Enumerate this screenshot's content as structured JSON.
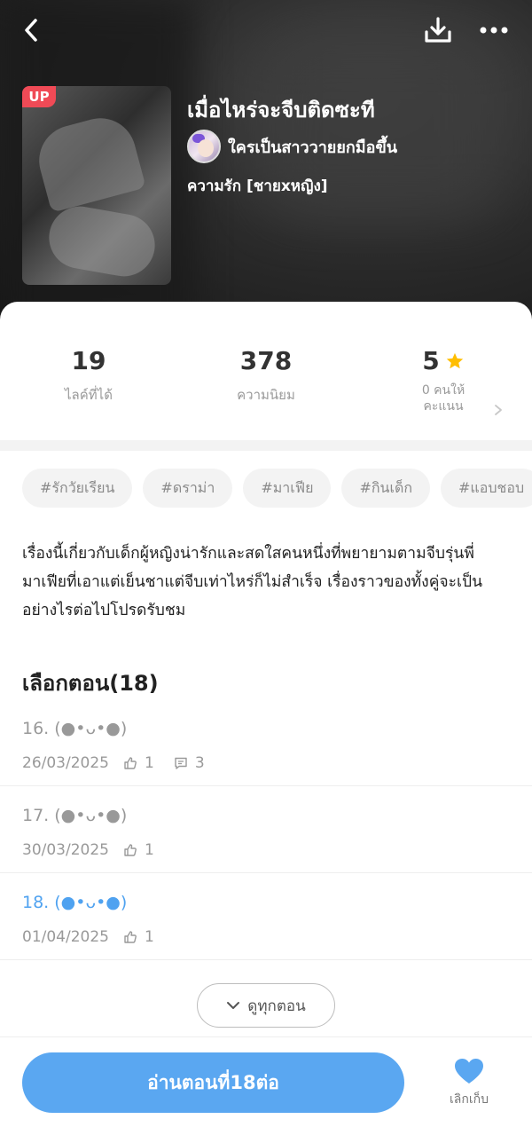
{
  "header": {
    "badge": "UP",
    "title": "เมื่อไหร่จะจีบติดซะที",
    "author": "ใครเป็นสาววายยกมือขึ้น",
    "genre": "ความรัก [ชายxหญิง]"
  },
  "stats": {
    "likes": {
      "value": "19",
      "label": "ไลค์ที่ได้"
    },
    "popularity": {
      "value": "378",
      "label": "ความนิยม"
    },
    "rating": {
      "value": "5",
      "label_line1": "0 คนให้",
      "label_line2": "คะแนน"
    }
  },
  "tags": [
    "#รักวัยเรียน",
    "#ดราม่า",
    "#มาเฟีย",
    "#กินเด็ก",
    "#แอบชอบ"
  ],
  "synopsis": "เรื่องนี้เกี่ยวกับเด็กผู้หญิงน่ารักและสดใสคนหนึ่งที่พยายามตามจีบรุ่นพี่มาเฟียที่เอาแต่เย็นชาแต่จีบเท่าไหร่ก็ไม่สำเร็จ เรื่องราวของทั้งคู่จะเป็นอย่างไรต่อไปโปรดรับชม",
  "episodes": {
    "heading": "เลือกตอน(18)",
    "items": [
      {
        "title": "16. (●•ᴗ•●)",
        "date": "26/03/2025",
        "likes": "1",
        "comments": "3"
      },
      {
        "title": "17. (●•ᴗ•●)",
        "date": "30/03/2025",
        "likes": "1"
      },
      {
        "title": "18. (●•ᴗ•●)",
        "date": "01/04/2025",
        "likes": "1"
      }
    ],
    "view_all": "ดูทุกตอน"
  },
  "actions": {
    "read": "อ่านตอนที่18ต่อ",
    "favorite": "เลิกเก็บ"
  },
  "colors": {
    "accent": "#5aa7f1",
    "current_episode": "#4fa2f0",
    "badge": "#f04a56",
    "star": "#ffbe00"
  },
  "icons": [
    "back-icon",
    "download-icon",
    "more-icon",
    "star-icon",
    "chevron-right-icon",
    "thumb-up-icon",
    "comment-icon",
    "chevron-down-icon",
    "heart-icon"
  ]
}
